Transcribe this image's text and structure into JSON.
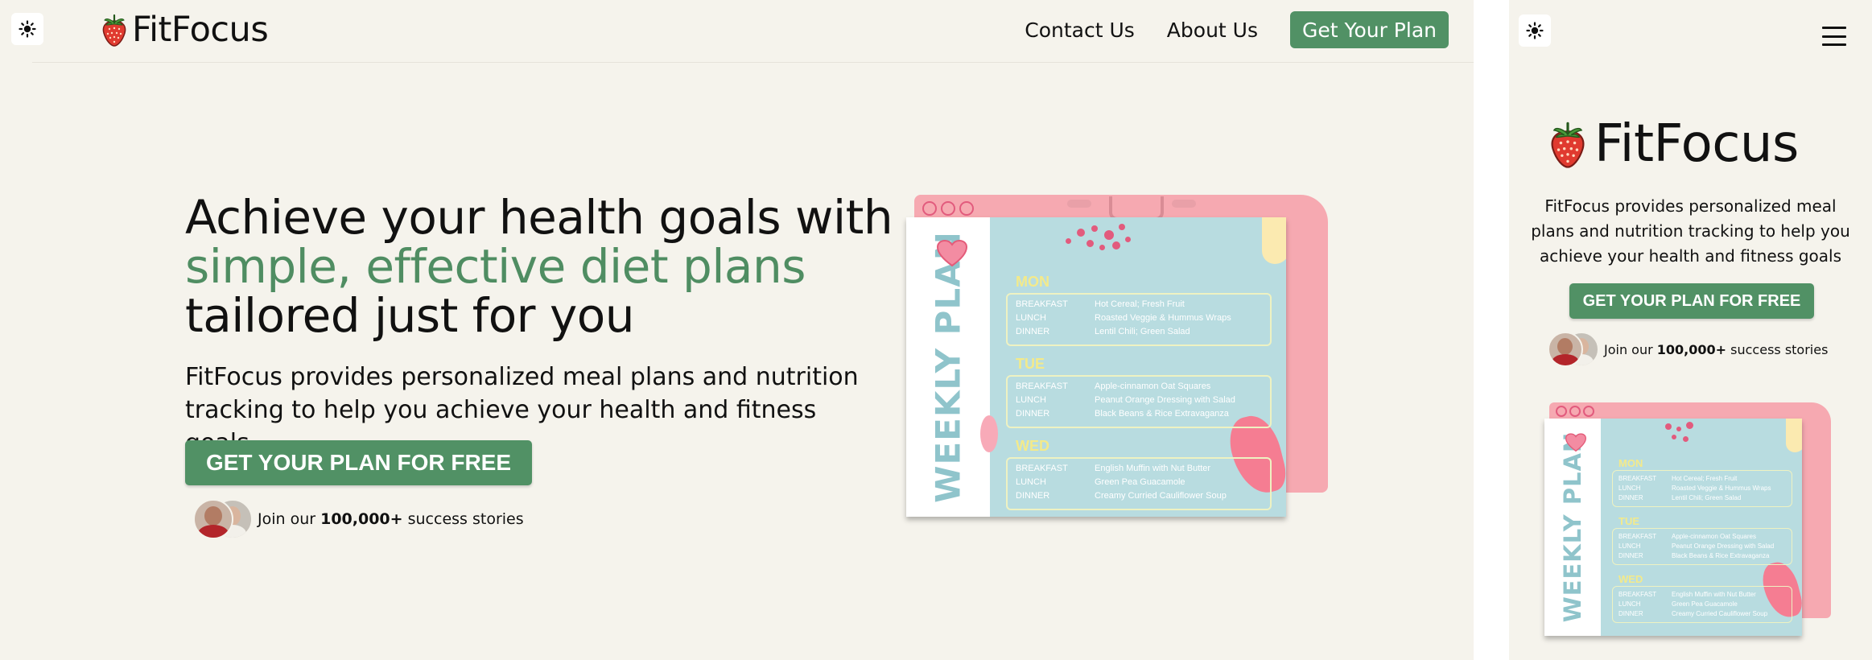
{
  "brand": {
    "name": "FitFocus",
    "logo_icon": "strawberry-icon"
  },
  "theme_toggle": {
    "icon": "sun-icon"
  },
  "nav": {
    "contact_label": "Contact Us",
    "about_label": "About Us",
    "cta_label": "Get Your Plan"
  },
  "hero": {
    "title_part1": "Achieve your health goals with ",
    "title_accent": "simple, effective diet plans",
    "title_part2": " tailored just for you",
    "subtitle": "FitFocus provides personalized meal plans and nutrition tracking to help you achieve your health and fitness goals",
    "cta_label": "GET YOUR PLAN FOR FREE",
    "social_prefix": "Join our ",
    "social_count": "100,000+",
    "social_suffix": " success stories"
  },
  "weekly_plan": {
    "title": "WEEKLY PLAN",
    "days": [
      {
        "day": "MON",
        "meals": [
          {
            "type": "BREAKFAST",
            "dish": "Hot Cereal; Fresh Fruit"
          },
          {
            "type": "LUNCH",
            "dish": "Roasted Veggie & Hummus Wraps"
          },
          {
            "type": "DINNER",
            "dish": "Lentil Chili; Green Salad"
          }
        ]
      },
      {
        "day": "TUE",
        "meals": [
          {
            "type": "BREAKFAST",
            "dish": "Apple-cinnamon Oat Squares"
          },
          {
            "type": "LUNCH",
            "dish": "Peanut Orange Dressing with Salad"
          },
          {
            "type": "DINNER",
            "dish": "Black Beans & Rice Extravaganza"
          }
        ]
      },
      {
        "day": "WED",
        "meals": [
          {
            "type": "BREAKFAST",
            "dish": "English Muffin with Nut Butter"
          },
          {
            "type": "LUNCH",
            "dish": "Green Pea Guacamole"
          },
          {
            "type": "DINNER",
            "dish": "Creamy Curried Cauliflower Soup"
          }
        ]
      }
    ]
  },
  "mobile": {
    "menu_icon": "hamburger-menu-icon"
  },
  "colors": {
    "background": "#f5f3ec",
    "accent": "#519165",
    "accent_text": "#4f8d62",
    "plan_card": "#b8dce0",
    "plan_back": "#f6a9b1"
  }
}
